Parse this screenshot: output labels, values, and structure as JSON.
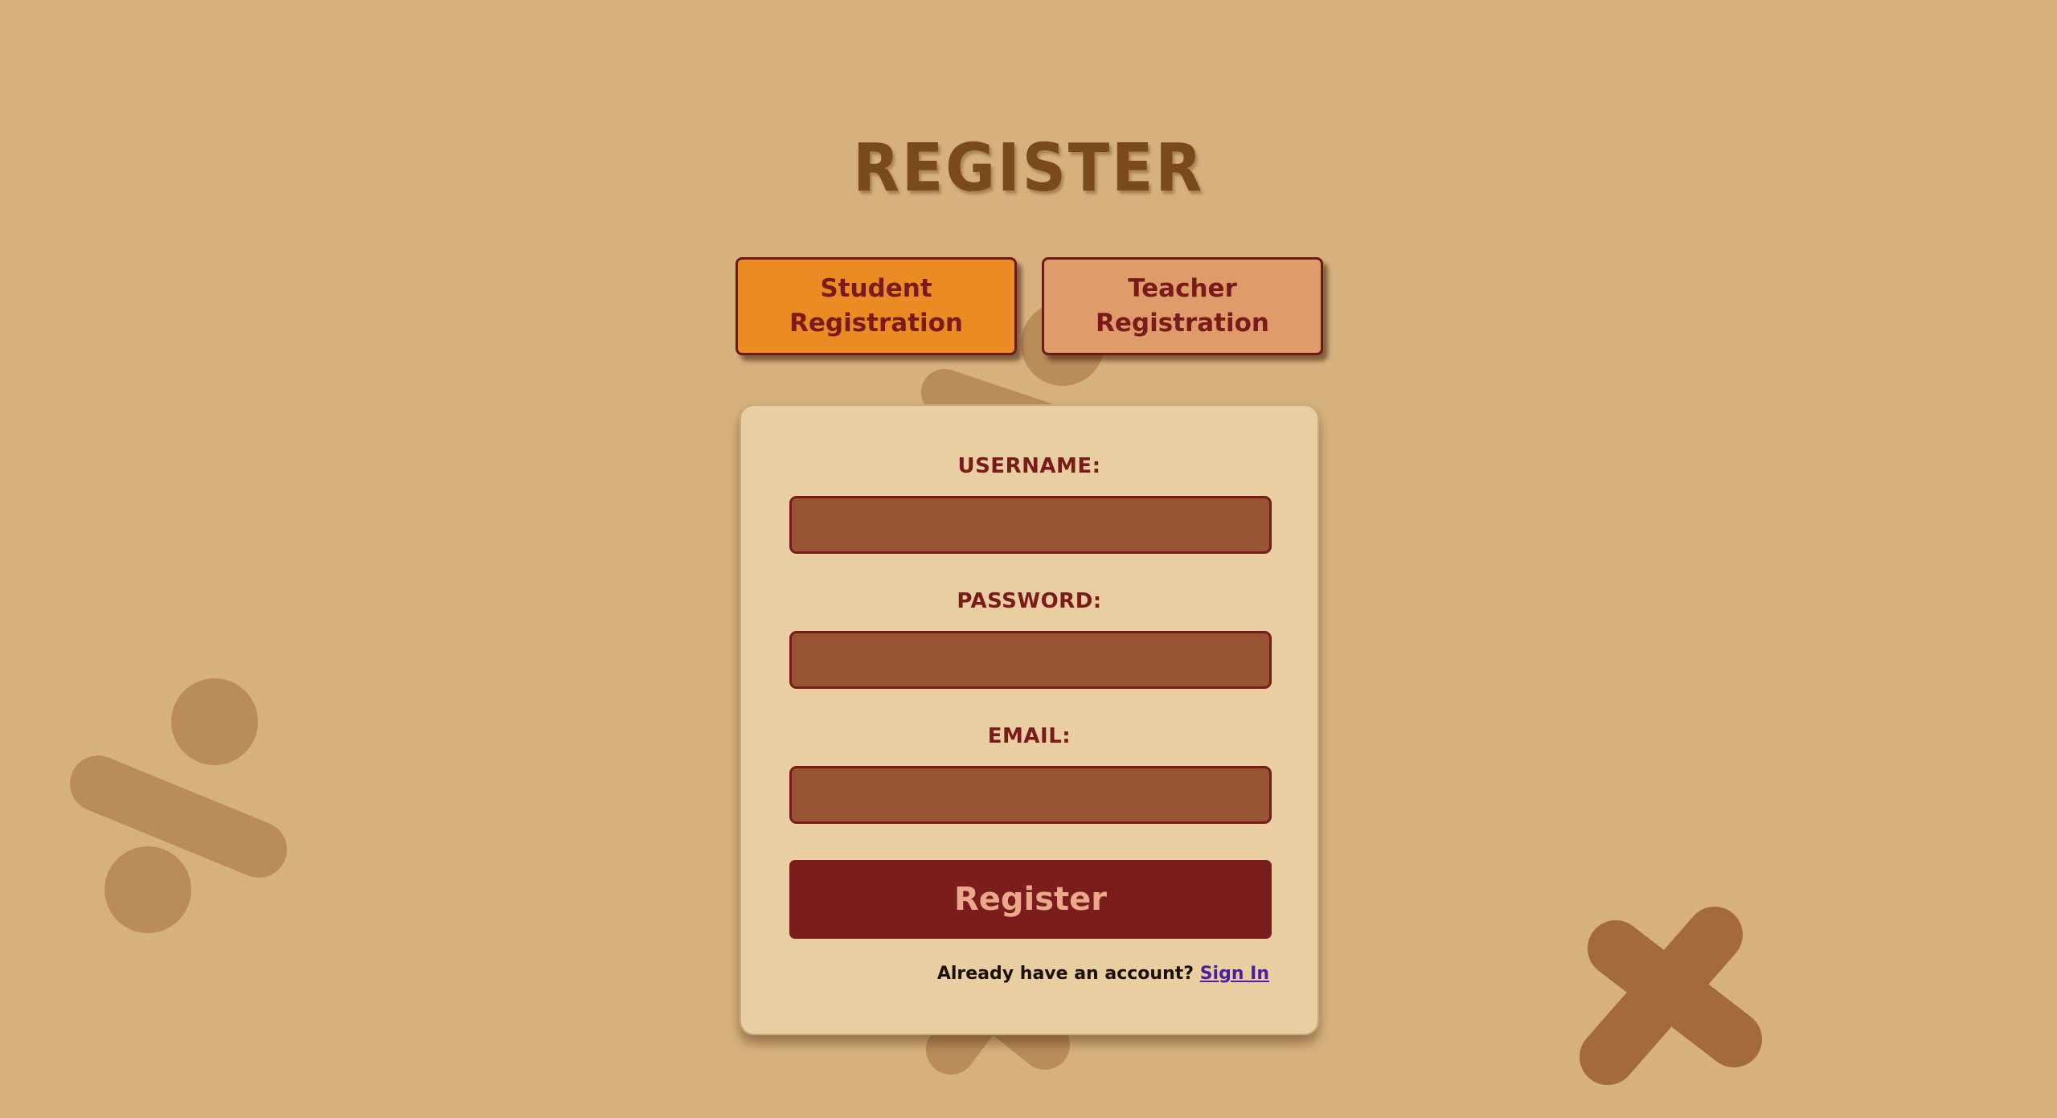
{
  "page": {
    "title": "REGISTER"
  },
  "tabs": {
    "student_label": "Student Registration",
    "teacher_label": "Teacher Registration"
  },
  "form": {
    "username_label": "USERNAME:",
    "username_value": "",
    "password_label": "PASSWORD:",
    "password_value": "",
    "email_label": "EMAIL:",
    "email_value": "",
    "submit_label": "Register"
  },
  "footer": {
    "prompt": "Already have an account?",
    "signin_link": "Sign In"
  },
  "colors": {
    "background": "#d7b17d",
    "title": "#7a4a1e",
    "student_tab": "#ea8b24",
    "teacher_tab": "#df9b69",
    "card": "#e9cea1",
    "input": "#985533",
    "accent_dark_red": "#7b1d1d",
    "button_text": "#eaa98a",
    "link": "#4b1fa1"
  },
  "decorations": {
    "icons": [
      "division-icon",
      "multiply-icon"
    ]
  }
}
